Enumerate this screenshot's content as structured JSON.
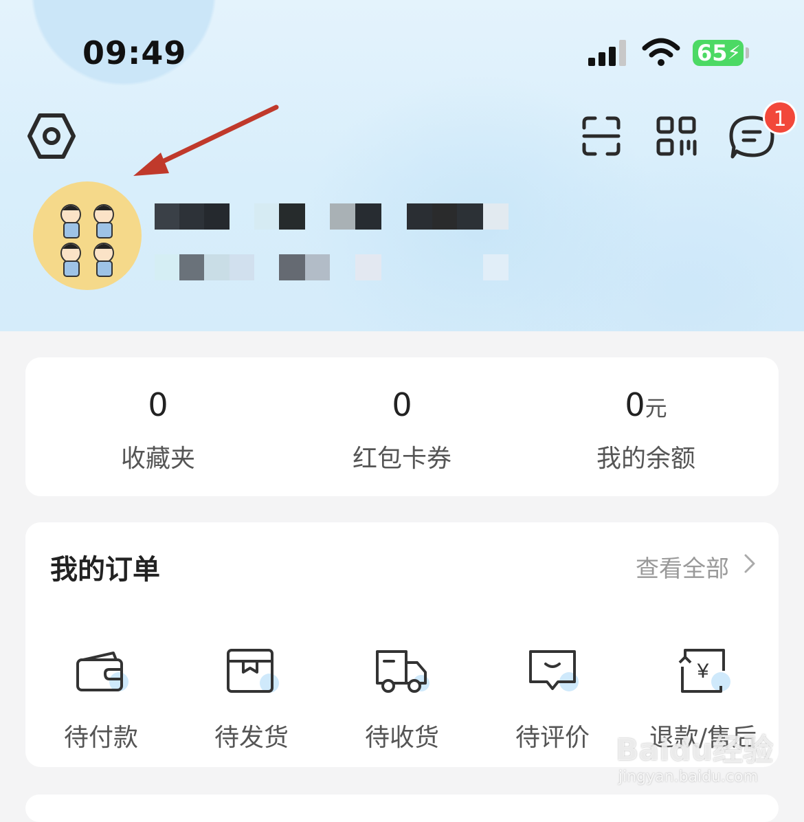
{
  "status_bar": {
    "time": "09:49",
    "battery": "65"
  },
  "header": {
    "icons": [
      "settings-icon",
      "scan-icon",
      "qr-code-icon",
      "message-icon"
    ],
    "message_badge": "1"
  },
  "stats": [
    {
      "value": "0",
      "unit": "",
      "label": "收藏夹"
    },
    {
      "value": "0",
      "unit": "",
      "label": "红包卡券"
    },
    {
      "value": "0",
      "unit": "元",
      "label": "我的余额"
    }
  ],
  "orders": {
    "title": "我的订单",
    "view_all": "查看全部",
    "items": [
      {
        "label": "待付款",
        "icon": "wallet-icon"
      },
      {
        "label": "待发货",
        "icon": "package-icon"
      },
      {
        "label": "待收货",
        "icon": "truck-icon"
      },
      {
        "label": "待评价",
        "icon": "comment-icon"
      },
      {
        "label": "退款/售后",
        "icon": "refund-icon"
      }
    ]
  },
  "watermark": {
    "logo": "Baidu经验",
    "url": "jingyan.baidu.com"
  },
  "colors": {
    "accent_blue": "#cfe9fb",
    "badge_red": "#f2483a",
    "battery_green": "#4cd964"
  }
}
